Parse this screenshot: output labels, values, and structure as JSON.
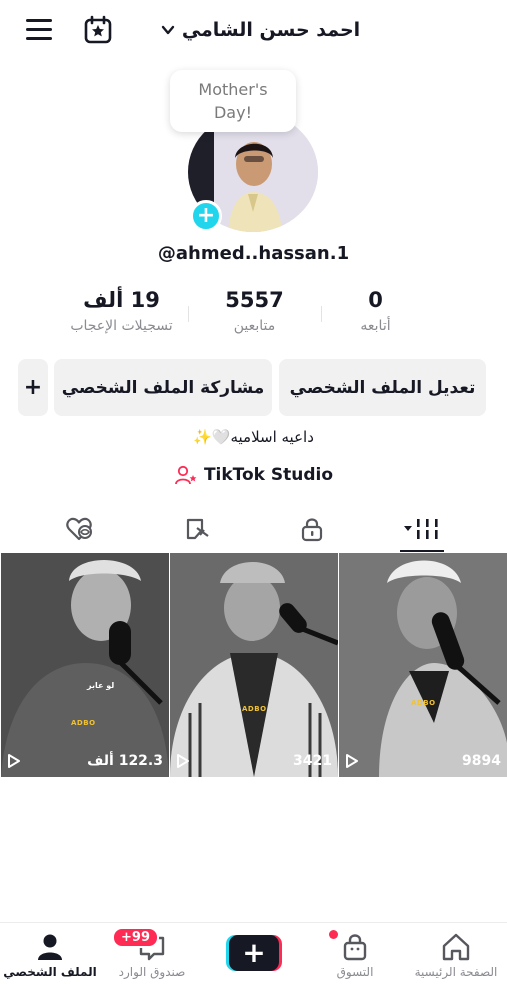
{
  "header": {
    "username": "احمد حسن الشامي",
    "icons": [
      "menu-icon",
      "calendar-star-icon",
      "chevron-down-icon"
    ]
  },
  "profile": {
    "note": "Mother's\nDay!",
    "handle": "@ahmed..hassan.1",
    "stats": {
      "following_count": "0",
      "following_label": "أتابعه",
      "followers_count": "5557",
      "followers_label": "متابعين",
      "likes_count": "19 ألف",
      "likes_label": "تسجيلات الإعجاب"
    },
    "buttons": {
      "edit": "تعديل الملف الشخصي",
      "share": "مشاركة الملف الشخصي",
      "add": "+"
    },
    "bio": "داعيه اسلاميه🤍✨",
    "studio": "TikTok Studio"
  },
  "tabs": [
    "videos-grid-icon",
    "lock-icon",
    "repost-icon",
    "liked-icon"
  ],
  "videos": [
    {
      "views": "9894",
      "overlay": "ADBO"
    },
    {
      "views": "3421",
      "overlay": "ADBO"
    },
    {
      "views": "122.3 ألف",
      "overlay": "ADBO",
      "caption": "لو عابر"
    }
  ],
  "bottom_nav": {
    "home": "الصفحة الرئيسية",
    "shop": "التسوق",
    "create": "+",
    "inbox": "صندوق الوارد",
    "inbox_badge": "+99",
    "profile": "الملف الشخصي"
  },
  "colors": {
    "accent_cyan": "#20d5ec",
    "accent_red": "#fe2c55",
    "text": "#161823",
    "muted": "#8a8b91",
    "button_bg": "#f1f1f2"
  }
}
